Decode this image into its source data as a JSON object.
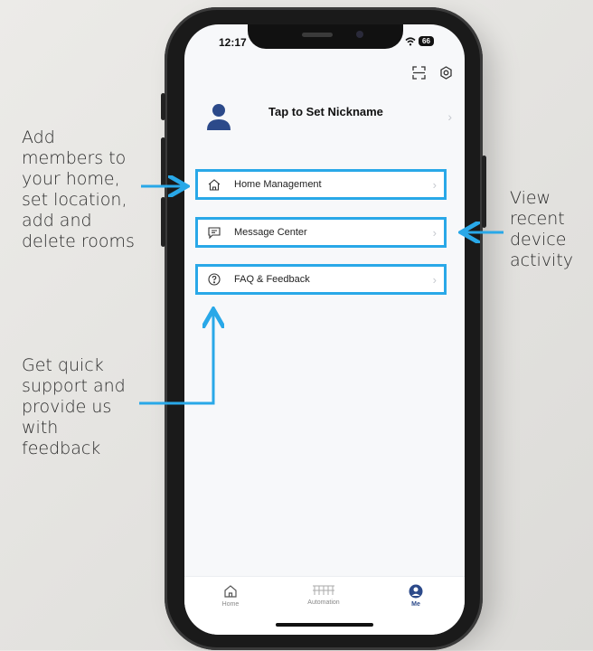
{
  "annotations": {
    "left_top": "Add\nmembers to\nyour home,\nset location,\nadd and\ndelete rooms",
    "left_bottom": "Get quick\nsupport and\nprovide us\nwith\nfeedback",
    "right": "View\nrecent\ndevice\nactivity"
  },
  "status_bar": {
    "time": "12:17",
    "battery": "66"
  },
  "header_icons": [
    "scan-icon",
    "settings-icon"
  ],
  "profile": {
    "nickname": "Tap to Set Nickname",
    "icon": "user-avatar-icon"
  },
  "menu": [
    {
      "label": "Home Management",
      "icon": "house-icon"
    },
    {
      "label": "Message Center",
      "icon": "message-icon"
    },
    {
      "label": "FAQ & Feedback",
      "icon": "question-icon"
    }
  ],
  "tabs": [
    {
      "label": "Home",
      "icon": "home-icon",
      "active": false
    },
    {
      "label": "Automation",
      "icon": "automation-icon",
      "active": false
    },
    {
      "label": "Me",
      "icon": "person-icon",
      "active": true
    }
  ],
  "colors": {
    "highlight": "#29a8e8",
    "accent": "#2c4a8a",
    "screen_bg": "#f7f8fa"
  }
}
